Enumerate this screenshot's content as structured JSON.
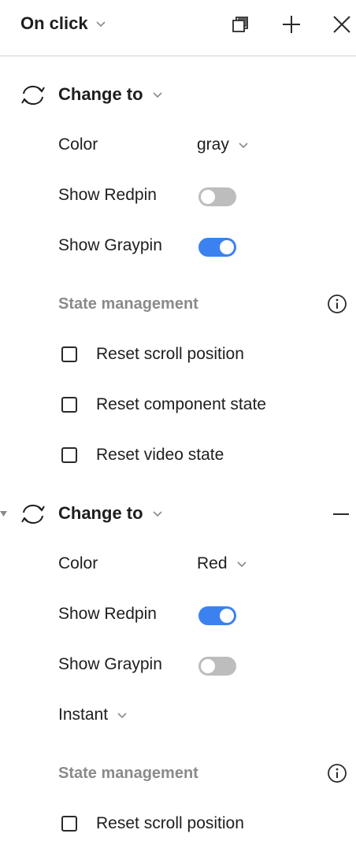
{
  "header": {
    "title": "On click",
    "icons": [
      "chevron-down-icon",
      "copy-icon",
      "plus-icon",
      "close-icon"
    ]
  },
  "actions": [
    {
      "title": "Change to",
      "icon": "swap-icon",
      "color_label": "Color",
      "color_value": "gray",
      "show_redpin_label": "Show Redpin",
      "show_redpin_on": false,
      "show_graypin_label": "Show Graypin",
      "show_graypin_on": true,
      "state_management_label": "State management",
      "checkboxes": [
        {
          "label": "Reset scroll position",
          "checked": false
        },
        {
          "label": "Reset component state",
          "checked": false
        },
        {
          "label": "Reset video state",
          "checked": false
        }
      ]
    },
    {
      "title": "Change to",
      "icon": "swap-icon",
      "color_label": "Color",
      "color_value": "Red",
      "show_redpin_label": "Show Redpin",
      "show_redpin_on": true,
      "show_graypin_label": "Show Graypin",
      "show_graypin_on": false,
      "transition_value": "Instant",
      "state_management_label": "State management",
      "checkboxes": [
        {
          "label": "Reset scroll position",
          "checked": false
        }
      ]
    }
  ],
  "colors": {
    "toggle_on": "#3b82f0",
    "toggle_off": "#bdbdbd",
    "section_label": "#8a8a8a"
  }
}
